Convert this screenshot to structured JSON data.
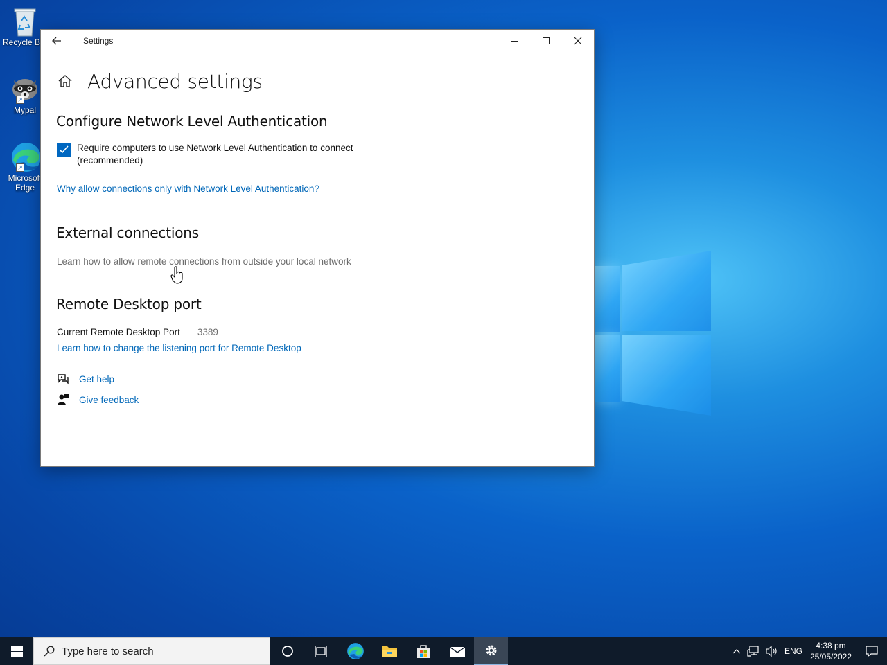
{
  "desktop": {
    "icons": [
      {
        "label": "Recycle Bin",
        "icon": "recycle-bin-icon"
      },
      {
        "label": "Mypal",
        "icon": "mypal-raccoon-icon"
      },
      {
        "label": "Microsoft Edge",
        "icon": "edge-icon"
      }
    ]
  },
  "window": {
    "title": "Settings",
    "page_title": "Advanced settings",
    "nla": {
      "heading": "Configure Network Level Authentication",
      "checkbox_label": "Require computers to use Network Level Authentication to connect (recommended)",
      "checked": true,
      "link": "Why allow connections only with Network Level Authentication?"
    },
    "external": {
      "heading": "External connections",
      "text": "Learn how to allow remote connections from outside your local network"
    },
    "port": {
      "heading": "Remote Desktop port",
      "label": "Current Remote Desktop Port",
      "value": "3389",
      "link": "Learn how to change the listening port for Remote Desktop"
    },
    "help": {
      "get_help": "Get help",
      "feedback": "Give feedback"
    }
  },
  "taskbar": {
    "search_placeholder": "Type here to search",
    "apps": [
      "cortana-icon",
      "task-view-icon",
      "edge-icon",
      "file-explorer-icon",
      "microsoft-store-icon",
      "mail-icon",
      "settings-icon"
    ],
    "active_app": "settings-icon",
    "language": "ENG",
    "time": "4:38 pm",
    "date": "25/05/2022"
  },
  "colors": {
    "accent": "#0067c0",
    "link": "#0067b8",
    "taskbar": "#0f1b2a"
  }
}
